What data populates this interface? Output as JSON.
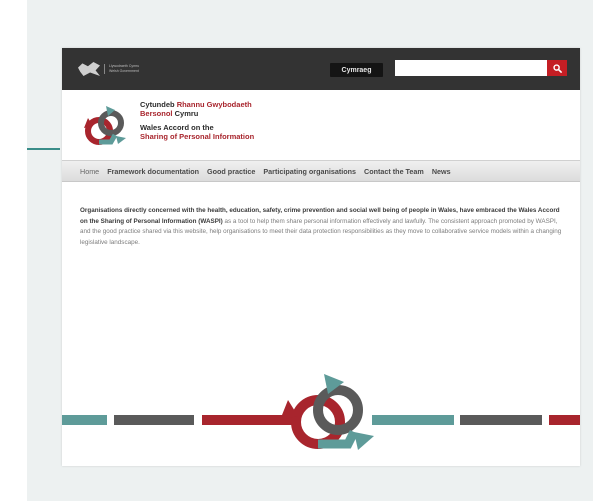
{
  "top_bar": {
    "gov_logo_text": [
      "Llywodraeth Cymru",
      "Welsh Government"
    ],
    "language_button": "Cymraeg",
    "search": {
      "placeholder": "",
      "value": ""
    }
  },
  "header": {
    "title_welsh_line1_dark": "Cytundeb",
    "title_welsh_line1_red": "Rhannu Gwybodaeth",
    "title_welsh_line2_red": "Bersonol",
    "title_welsh_line2_dark": "Cymru",
    "title_english_line1": "Wales Accord on the",
    "title_english_line2": "Sharing of Personal Information"
  },
  "nav": {
    "items": [
      "Home",
      "Framework documentation",
      "Good practice",
      "Participating organisations",
      "Contact the Team",
      "News"
    ]
  },
  "intro": {
    "bold_text": "Organisations directly concerned with the health, education, safety, crime prevention and  social well being of people in Wales, have embraced the Wales Accord on the Sharing of Personal Information (WASPI)",
    "normal_text": " as a tool to help them share personal information effectively and lawfully. The consistent approach promoted by WASPI, and the good practice shared via this website, help organisations to meet their data protection responsibilities as they move to collaborative service models within a changing legislative landscape."
  },
  "colors": {
    "brand_red": "#a8252d",
    "brand_teal": "#5e9b99",
    "brand_grey": "#5a5a5a",
    "top_bar": "#333333",
    "search_button": "#c41e24"
  },
  "icons": {
    "gov_logo": "welsh-dragon-icon",
    "search": "search-icon",
    "site_logo": "interlocking-arrows-logo"
  }
}
